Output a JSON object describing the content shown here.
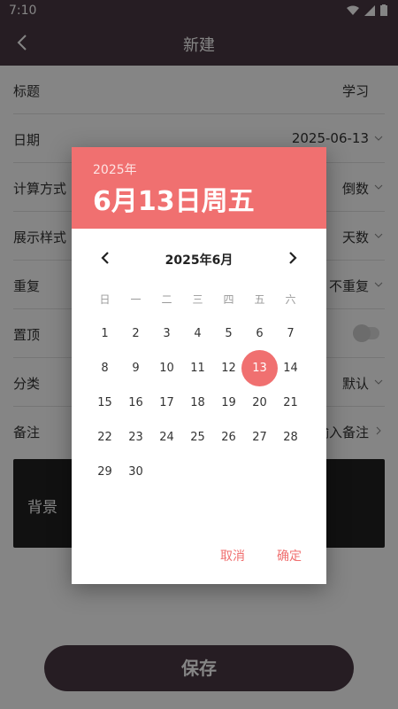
{
  "status": {
    "time": "7:10"
  },
  "app": {
    "title": "新建"
  },
  "form": {
    "title": {
      "label": "标题",
      "value": "学习"
    },
    "date": {
      "label": "日期",
      "value": "2025-06-13"
    },
    "calc": {
      "label": "计算方式",
      "value": "倒数"
    },
    "display": {
      "label": "展示样式",
      "value": "天数"
    },
    "repeat": {
      "label": "重复",
      "value": "不重复"
    },
    "pin": {
      "label": "置顶",
      "on": false
    },
    "category": {
      "label": "分类",
      "value": "默认"
    },
    "note": {
      "label": "备注",
      "value": "输入备注"
    },
    "background": {
      "label": "背景"
    }
  },
  "save_label": "保存",
  "dialog": {
    "year": "2025年",
    "selected_date": "6月13日周五",
    "month_title": "2025年6月",
    "weekdays": [
      "日",
      "一",
      "二",
      "三",
      "四",
      "五",
      "六"
    ],
    "weeks": [
      [
        "1",
        "2",
        "3",
        "4",
        "5",
        "6",
        "7"
      ],
      [
        "8",
        "9",
        "10",
        "11",
        "12",
        "13",
        "14"
      ],
      [
        "15",
        "16",
        "17",
        "18",
        "19",
        "20",
        "21"
      ],
      [
        "22",
        "23",
        "24",
        "25",
        "26",
        "27",
        "28"
      ],
      [
        "29",
        "30"
      ]
    ],
    "selected_day": "13",
    "cancel": "取消",
    "ok": "确定"
  },
  "colors": {
    "accent": "#f07070",
    "appbar": "#4a3944"
  }
}
